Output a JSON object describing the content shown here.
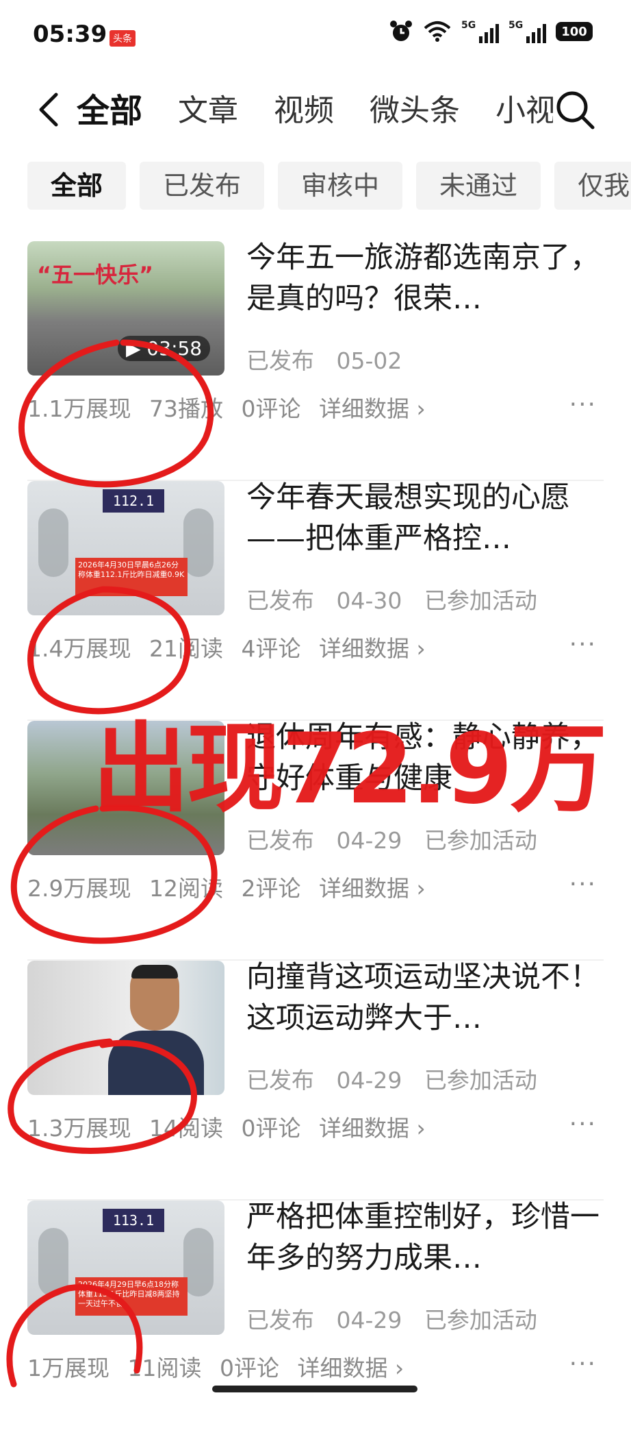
{
  "status_bar": {
    "time": "05:39",
    "app_badge": "头条",
    "signal_1": "5G",
    "signal_2": "5G",
    "battery": "100",
    "icons": [
      "alarm-icon",
      "wifi-icon",
      "signal-icon",
      "battery-icon"
    ]
  },
  "tabs": [
    "全部",
    "文章",
    "视频",
    "微头条",
    "小视"
  ],
  "filters": [
    "全部",
    "已发布",
    "审核中",
    "未通过",
    "仅我"
  ],
  "items": [
    {
      "title": "今年五一旅游都选南京了，是真的吗？很荣…",
      "status": "已发布",
      "date": "05-02",
      "activity": "",
      "stats": [
        "1.1万展现",
        "73播放",
        "0评论",
        "详细数据 ›"
      ],
      "thumb_text": "“五一快乐”",
      "duration": "▶ 03:58"
    },
    {
      "title": "今年春天最想实现的心愿——把体重严格控…",
      "status": "已发布",
      "date": "04-30",
      "activity": "已参加活动",
      "stats": [
        "1.4万展现",
        "21阅读",
        "4评论",
        "详细数据 ›"
      ],
      "scale_reading": "112.1",
      "stamp": "2026年4月30日早晨6点26分称体重112.1斤比昨日减重0.9K"
    },
    {
      "title": "退休周年有感：静心静养，守好体重与健康",
      "status": "已发布",
      "date": "04-29",
      "activity": "已参加活动",
      "stats": [
        "2.9万展现",
        "12阅读",
        "2评论",
        "详细数据 ›"
      ]
    },
    {
      "title": "向撞背这项运动坚决说不！这项运动弊大于…",
      "status": "已发布",
      "date": "04-29",
      "activity": "已参加活动",
      "stats": [
        "1.3万展现",
        "14阅读",
        "0评论",
        "详细数据 ›"
      ]
    },
    {
      "title": "严格把体重控制好，珍惜一年多的努力成果…",
      "status": "已发布",
      "date": "04-29",
      "activity": "已参加活动",
      "stats": [
        "1万展现",
        "11阅读",
        "0评论",
        "详细数据 ›"
      ],
      "scale_reading": "113.1",
      "stamp": "2026年4月29日早6点18分称体重113.1斤比昨日减8两坚持一天过午不食"
    }
  ],
  "more_label": "···",
  "overlay_text": "出现72.9万",
  "annotation_color": "#e41b1b"
}
